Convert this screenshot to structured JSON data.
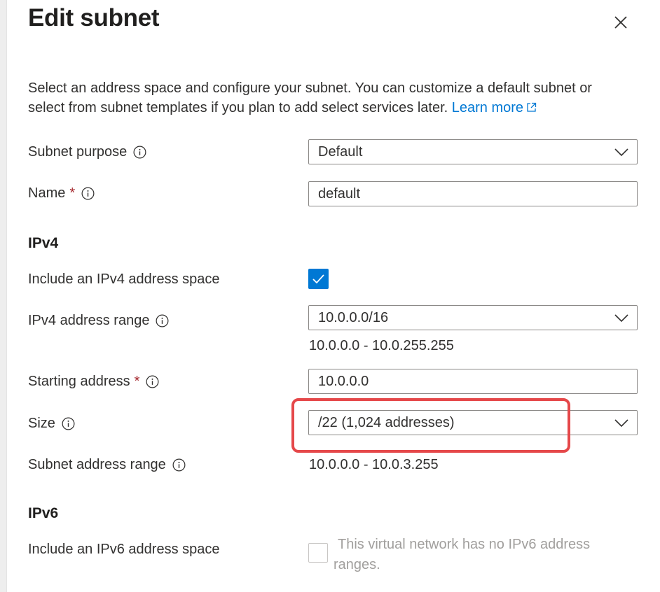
{
  "title": "Edit subnet",
  "description": {
    "text": "Select an address space and configure your subnet. You can customize a default subnet or select from subnet templates if you plan to add select services later.",
    "link_label": "Learn more"
  },
  "subnet_purpose": {
    "label": "Subnet purpose",
    "value": "Default"
  },
  "name": {
    "label": "Name",
    "required_mark": "*",
    "value": "default"
  },
  "ipv4": {
    "heading": "IPv4",
    "include_label": "Include an IPv4 address space",
    "include_checked": true,
    "address_range_label": "IPv4 address range",
    "address_range_value": "10.0.0.0/16",
    "address_range_detail": "10.0.0.0 - 10.0.255.255",
    "starting_address_label": "Starting address",
    "starting_address_required": "*",
    "starting_address_value": "10.0.0.0",
    "size_label": "Size",
    "size_value": "/22 (1,024 addresses)",
    "subnet_range_label": "Subnet address range",
    "subnet_range_value": "10.0.0.0 - 10.0.3.255"
  },
  "ipv6": {
    "heading": "IPv6",
    "include_label": "Include an IPv6 address space",
    "include_checked": false,
    "disabled_note": "This virtual network has no IPv6 address ranges."
  },
  "colors": {
    "accent": "#0078d4",
    "highlight": "#e5484a",
    "required": "#a4262c",
    "disabled_text": "#a19f9d"
  },
  "icons": {
    "close": "close-icon",
    "info": "info-icon",
    "dropdown": "chevron-down-icon",
    "external_link": "external-link-icon",
    "check": "checkmark-icon"
  }
}
